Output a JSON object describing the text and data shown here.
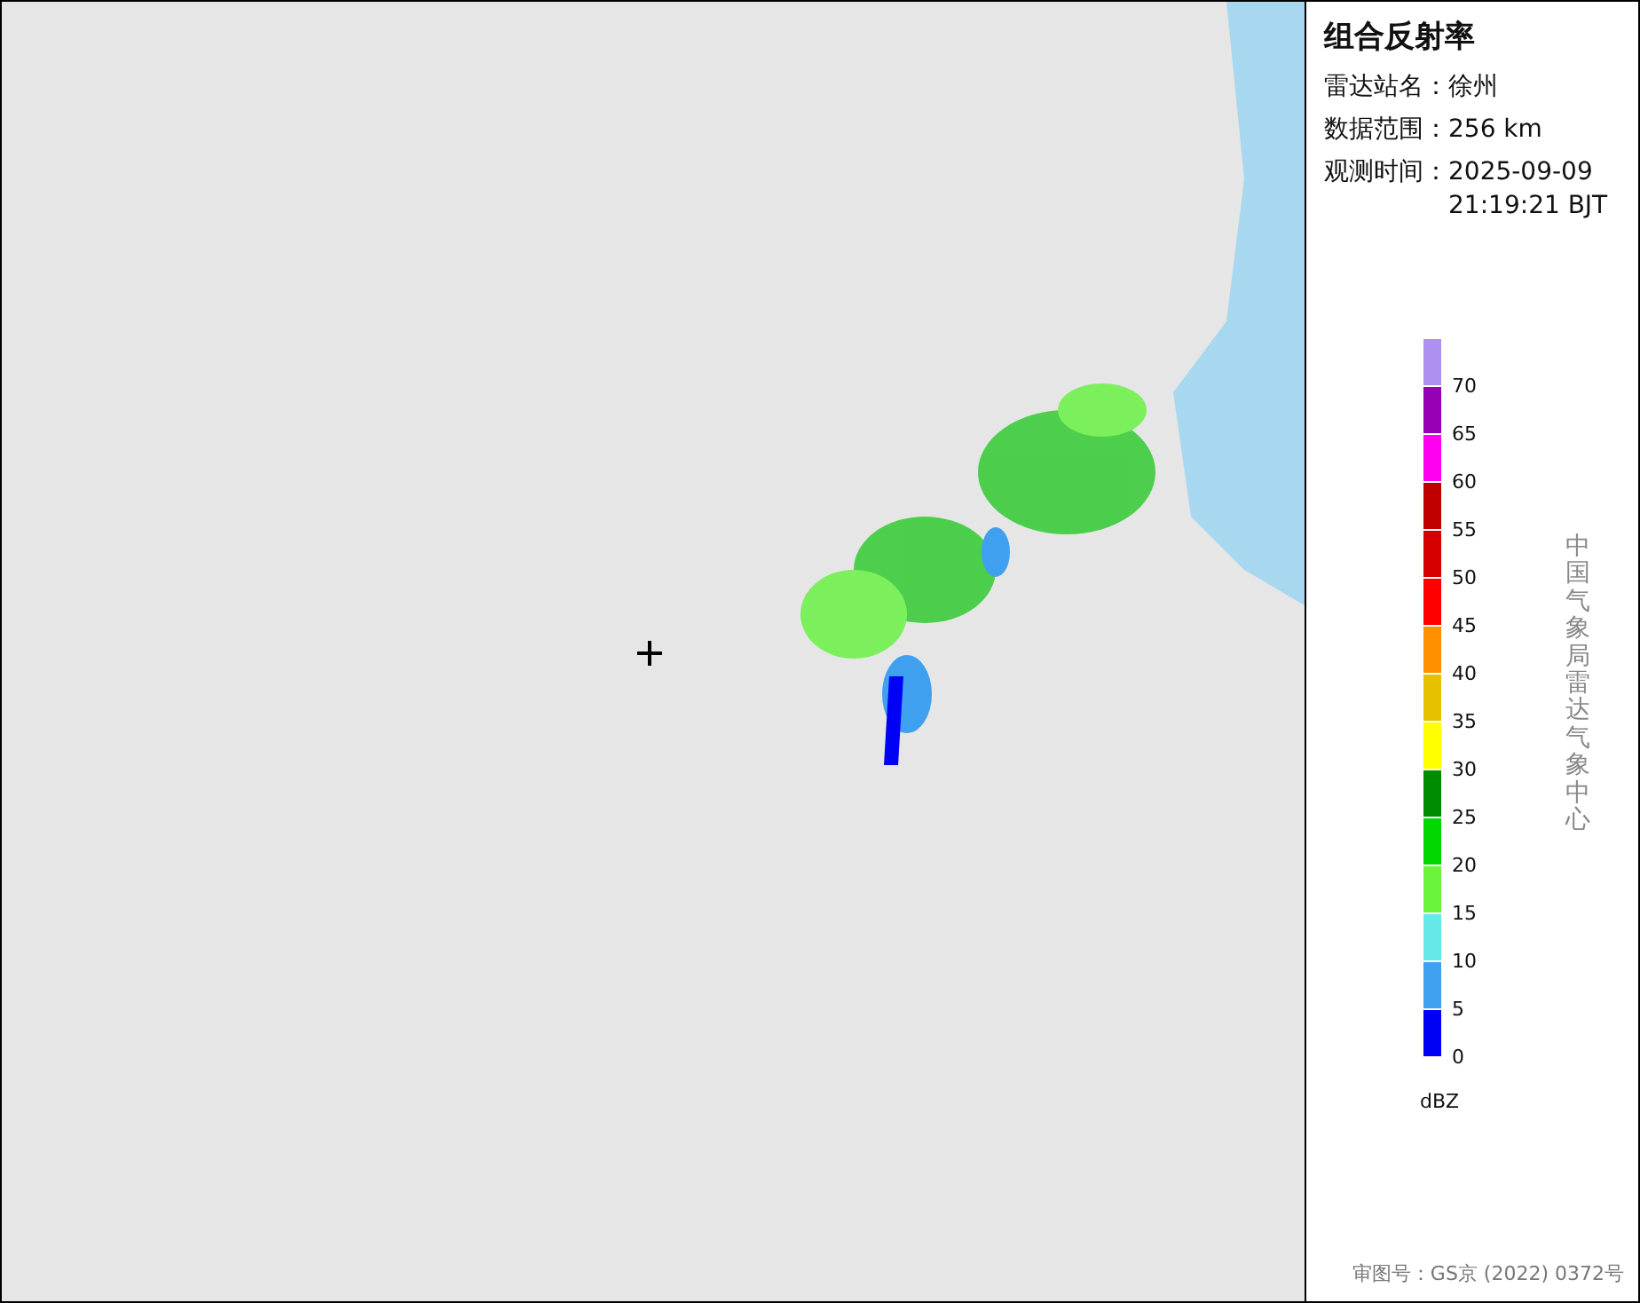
{
  "panel": {
    "title": "组合反射率",
    "fields": [
      {
        "label": "雷达站名：",
        "value": "徐州"
      },
      {
        "label": "数据范围：",
        "value": "256 km"
      },
      {
        "label": "观测时间：",
        "value": "2025-09-09 21:19:21 BJT"
      }
    ]
  },
  "legend": {
    "unit": "dBZ",
    "bands": [
      {
        "color": "#ad90f0",
        "label": "70"
      },
      {
        "color": "#9600b4",
        "label": "65"
      },
      {
        "color": "#ff00f0",
        "label": "60"
      },
      {
        "color": "#c00000",
        "label": "55"
      },
      {
        "color": "#d60000",
        "label": "50"
      },
      {
        "color": "#ff0000",
        "label": "45"
      },
      {
        "color": "#ff9000",
        "label": "40"
      },
      {
        "color": "#e7c000",
        "label": "35"
      },
      {
        "color": "#ffff00",
        "label": "30"
      },
      {
        "color": "#008c00",
        "label": "25"
      },
      {
        "color": "#00d800",
        "label": "20"
      },
      {
        "color": "#6cf43c",
        "label": "15"
      },
      {
        "color": "#66e8e8",
        "label": "10"
      },
      {
        "color": "#40a0f0",
        "label": "5"
      },
      {
        "color": "#0000f6",
        "label": "0"
      }
    ]
  },
  "credit": "中国气象局雷达气象中心",
  "approval": "审图号：GS京 (2022) 0372号"
}
